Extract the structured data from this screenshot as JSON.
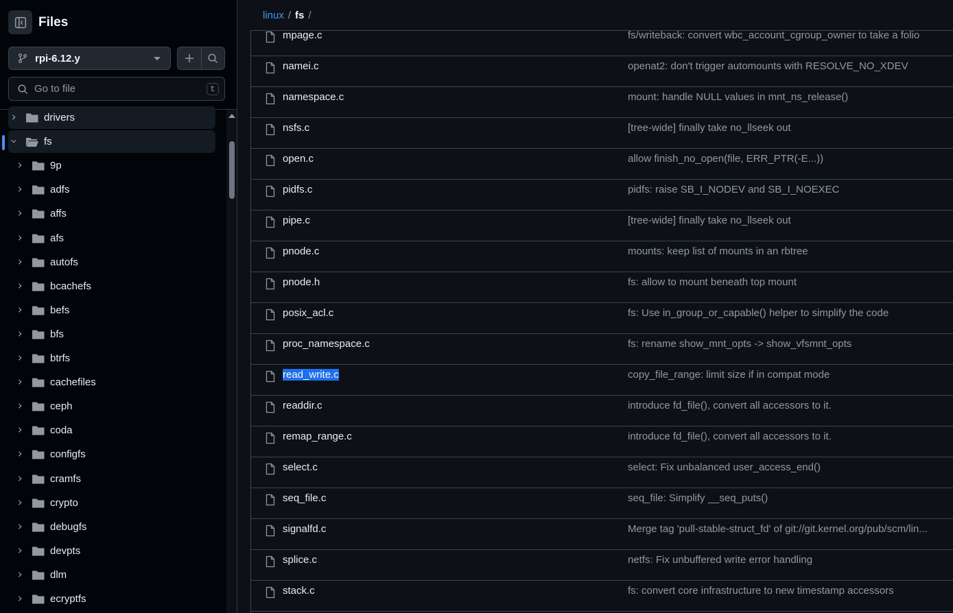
{
  "sidebar": {
    "title": "Files",
    "branch": "rpi-6.12.y",
    "search_placeholder": "Go to file",
    "search_shortcut": "t",
    "tree": [
      {
        "label": "drivers",
        "level": 0,
        "expanded": false
      },
      {
        "label": "fs",
        "level": 0,
        "expanded": true,
        "current": true
      },
      {
        "label": "9p",
        "level": 1,
        "expanded": false
      },
      {
        "label": "adfs",
        "level": 1,
        "expanded": false
      },
      {
        "label": "affs",
        "level": 1,
        "expanded": false
      },
      {
        "label": "afs",
        "level": 1,
        "expanded": false
      },
      {
        "label": "autofs",
        "level": 1,
        "expanded": false
      },
      {
        "label": "bcachefs",
        "level": 1,
        "expanded": false
      },
      {
        "label": "befs",
        "level": 1,
        "expanded": false
      },
      {
        "label": "bfs",
        "level": 1,
        "expanded": false
      },
      {
        "label": "btrfs",
        "level": 1,
        "expanded": false
      },
      {
        "label": "cachefiles",
        "level": 1,
        "expanded": false
      },
      {
        "label": "ceph",
        "level": 1,
        "expanded": false
      },
      {
        "label": "coda",
        "level": 1,
        "expanded": false
      },
      {
        "label": "configfs",
        "level": 1,
        "expanded": false
      },
      {
        "label": "cramfs",
        "level": 1,
        "expanded": false
      },
      {
        "label": "crypto",
        "level": 1,
        "expanded": false
      },
      {
        "label": "debugfs",
        "level": 1,
        "expanded": false
      },
      {
        "label": "devpts",
        "level": 1,
        "expanded": false
      },
      {
        "label": "dlm",
        "level": 1,
        "expanded": false
      },
      {
        "label": "ecryptfs",
        "level": 1,
        "expanded": false
      }
    ]
  },
  "breadcrumb": {
    "root": "linux",
    "separator": "/",
    "current": "fs",
    "trailing": "/"
  },
  "files": [
    {
      "name": "mpage.c",
      "commit": "fs/writeback: convert wbc_account_cgroup_owner to take a folio"
    },
    {
      "name": "namei.c",
      "commit": "openat2: don't trigger automounts with RESOLVE_NO_XDEV"
    },
    {
      "name": "namespace.c",
      "commit": "mount: handle NULL values in mnt_ns_release()"
    },
    {
      "name": "nsfs.c",
      "commit": "[tree-wide] finally take no_llseek out"
    },
    {
      "name": "open.c",
      "commit": "allow finish_no_open(file, ERR_PTR(-E...))"
    },
    {
      "name": "pidfs.c",
      "commit": "pidfs: raise SB_I_NODEV and SB_I_NOEXEC"
    },
    {
      "name": "pipe.c",
      "commit": "[tree-wide] finally take no_llseek out"
    },
    {
      "name": "pnode.c",
      "commit": "mounts: keep list of mounts in an rbtree"
    },
    {
      "name": "pnode.h",
      "commit": "fs: allow to mount beneath top mount"
    },
    {
      "name": "posix_acl.c",
      "commit": "fs: Use in_group_or_capable() helper to simplify the code"
    },
    {
      "name": "proc_namespace.c",
      "commit": "fs: rename show_mnt_opts -> show_vfsmnt_opts"
    },
    {
      "name": "read_write.c",
      "commit": "copy_file_range: limit size if in compat mode",
      "selected": true
    },
    {
      "name": "readdir.c",
      "commit": "introduce fd_file(), convert all accessors to it."
    },
    {
      "name": "remap_range.c",
      "commit": "introduce fd_file(), convert all accessors to it."
    },
    {
      "name": "select.c",
      "commit": "select: Fix unbalanced user_access_end()"
    },
    {
      "name": "seq_file.c",
      "commit": "seq_file: Simplify __seq_puts()"
    },
    {
      "name": "signalfd.c",
      "commit": "Merge tag 'pull-stable-struct_fd' of git://git.kernel.org/pub/scm/lin..."
    },
    {
      "name": "splice.c",
      "commit": "netfs: Fix unbuffered write error handling"
    },
    {
      "name": "stack.c",
      "commit": "fs: convert core infrastructure to new timestamp accessors"
    }
  ],
  "colors": {
    "accent": "#4493f8",
    "selection": "#1f6feb",
    "folder": "#9198a1"
  }
}
